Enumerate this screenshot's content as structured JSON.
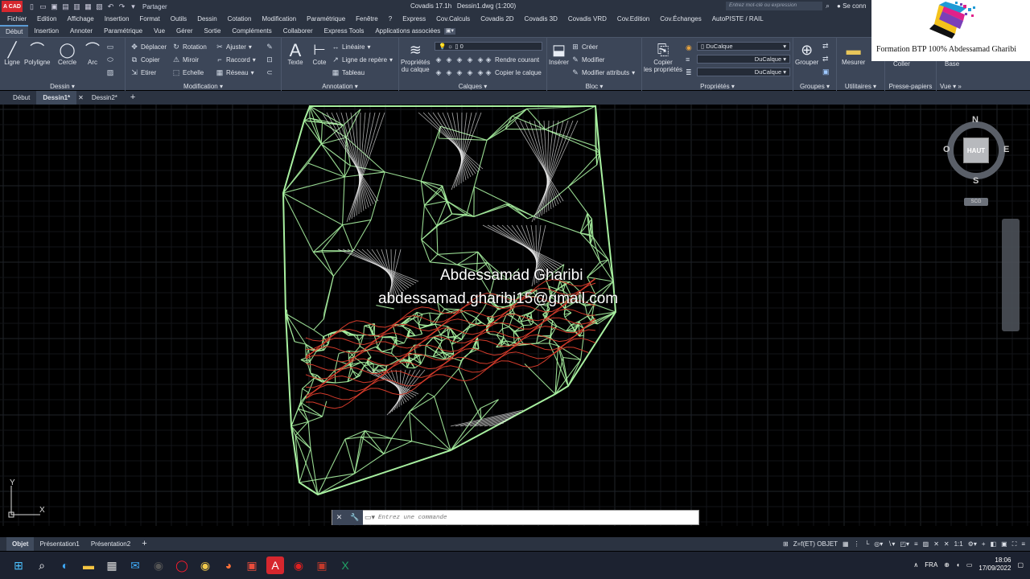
{
  "titlebar": {
    "logo_text": "A CAD",
    "share_label": "Partager",
    "window_title": "Covadis 17.1h",
    "file_title": "Dessin1.dwg (1:200)",
    "search_placeholder": "Entrez mot-clé ou expression",
    "signin_label": "Se conn"
  },
  "menubar": {
    "items": [
      "Fichier",
      "Edition",
      "Affichage",
      "Insertion",
      "Format",
      "Outils",
      "Dessin",
      "Cotation",
      "Modification",
      "Paramétrique",
      "Fenêtre",
      "?",
      "Express",
      "Cov.Calculs",
      "Covadis 2D",
      "Covadis 3D",
      "Covadis VRD",
      "Cov.Edition",
      "Cov.Échanges",
      "AutoPISTE / RAIL"
    ]
  },
  "ribbon_tabs": {
    "items": [
      "Début",
      "Insertion",
      "Annoter",
      "Paramétrique",
      "Vue",
      "Gérer",
      "Sortie",
      "Compléments",
      "Collaborer",
      "Express Tools",
      "Applications associées"
    ]
  },
  "ribbon": {
    "dessin": {
      "title": "Dessin",
      "ligne": "Ligne",
      "polyligne": "Polyligne",
      "cercle": "Cercle",
      "arc": "Arc"
    },
    "modification": {
      "title": "Modification",
      "deplacer": "Déplacer",
      "rotation": "Rotation",
      "ajuster": "Ajuster",
      "copier": "Copier",
      "miroir": "Miroir",
      "raccord": "Raccord",
      "etirer": "Etirer",
      "echelle": "Echelle",
      "reseau": "Réseau"
    },
    "annotation": {
      "title": "Annotation",
      "texte": "Texte",
      "cote": "Cote",
      "lineaire": "Linéaire",
      "ligne_repere": "Ligne de repère",
      "tableau": "Tableau"
    },
    "calques": {
      "title": "Calques",
      "proprietes": "Propriétés\ndu calque",
      "proprietes_line1": "Propriétés",
      "proprietes_line2": "du calque",
      "current_layer": "0",
      "rendre_courant": "Rendre courant",
      "copier_calque": "Copier le calque"
    },
    "bloc": {
      "title": "Bloc",
      "inserer": "Insérer",
      "creer": "Créer",
      "modifier": "Modifier",
      "modifier_attributs": "Modifier attributs"
    },
    "proprietes": {
      "title": "Propriétés",
      "copier_line1": "Copier",
      "copier_line2": "les propriétés",
      "color": "DuCalque",
      "linetype": "DuCalque",
      "lineweight": "DuCalque"
    },
    "groupes": {
      "title": "Groupes",
      "grouper": "Grouper"
    },
    "utilitaires": {
      "title": "Utilitaires",
      "mesurer": "Mesurer"
    },
    "presse_papiers": {
      "title": "Presse-papiers",
      "coller": "Coller"
    },
    "vue": {
      "title": "Vue",
      "base": "Base"
    }
  },
  "watermark": {
    "text": "Formation BTP 100% Abdessamad Gharibi"
  },
  "doc_tabs": {
    "items": [
      "Début",
      "Dessin1*",
      "Dessin2*"
    ],
    "add": "+"
  },
  "viewcube": {
    "n": "N",
    "s": "S",
    "e": "E",
    "o": "O",
    "top": "HAUT",
    "scg": "SCG"
  },
  "overlay": {
    "name": "Abdessamad Gharibi",
    "email": "abdessamad.gharibi15@gmail.com"
  },
  "ucs": {
    "x": "X",
    "y": "Y"
  },
  "command": {
    "placeholder": "Entrez une commande"
  },
  "layout_tabs": {
    "items": [
      "Objet",
      "Présentation1",
      "Présentation2"
    ],
    "add": "+"
  },
  "statusbar": {
    "zmode": "Z=f(ET) OBJET",
    "scale": "1:1"
  },
  "taskbar": {
    "lang": "FRA",
    "time": "18:06",
    "date": "17/09/2022"
  },
  "colors": {
    "tin_green": "#a8f0a0",
    "contour_red": "#d23a2a",
    "ui_dark": "#2b3341",
    "ribbon": "#3c4658"
  }
}
